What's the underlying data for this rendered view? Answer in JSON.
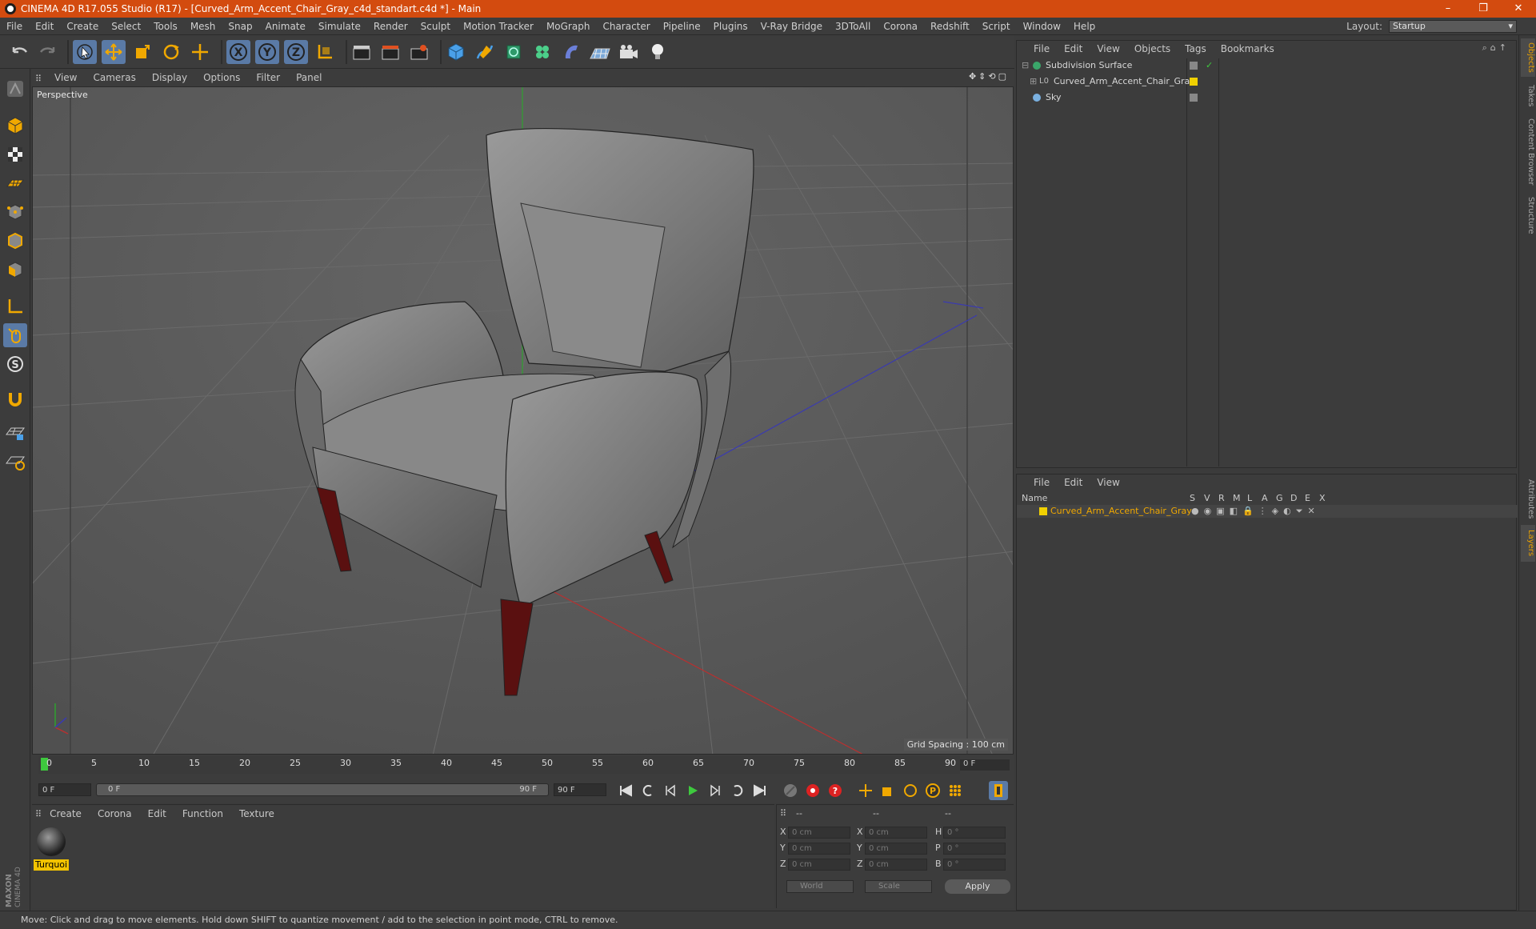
{
  "window": {
    "title": "CINEMA 4D R17.055 Studio (R17) - [Curved_Arm_Accent_Chair_Gray_c4d_standart.c4d *] - Main",
    "minimize": "–",
    "restore": "❐",
    "close": "✕"
  },
  "menubar": {
    "items": [
      "File",
      "Edit",
      "Create",
      "Select",
      "Tools",
      "Mesh",
      "Snap",
      "Animate",
      "Simulate",
      "Render",
      "Sculpt",
      "Motion Tracker",
      "MoGraph",
      "Character",
      "Pipeline",
      "Plugins",
      "V-Ray Bridge",
      "3DToAll",
      "Corona",
      "Redshift",
      "Script",
      "Window",
      "Help"
    ],
    "layout_label": "Layout:",
    "layout_value": "Startup"
  },
  "viewport": {
    "menu": [
      "View",
      "Cameras",
      "Display",
      "Options",
      "Filter",
      "Panel"
    ],
    "label": "Perspective",
    "grid_spacing": "Grid Spacing : 100 cm"
  },
  "timeline": {
    "ticks": [
      "0",
      "5",
      "10",
      "15",
      "20",
      "25",
      "30",
      "35",
      "40",
      "45",
      "50",
      "55",
      "60",
      "65",
      "70",
      "75",
      "80",
      "85",
      "90"
    ],
    "end_frame_ruler": "0 F",
    "current_frame": "0 F",
    "range_start": "0 F",
    "range_end": "90 F",
    "max_frame": "90 F"
  },
  "material_manager": {
    "menu": [
      "Create",
      "Corona",
      "Edit",
      "Function",
      "Texture"
    ],
    "material_name": "Turquoi"
  },
  "coordinates": {
    "header": [
      "--",
      "--",
      "--"
    ],
    "rows": [
      {
        "a": "X",
        "av": "0 cm",
        "b": "X",
        "bv": "0 cm",
        "c": "H",
        "cv": "0 °"
      },
      {
        "a": "Y",
        "av": "0 cm",
        "b": "Y",
        "bv": "0 cm",
        "c": "P",
        "cv": "0 °"
      },
      {
        "a": "Z",
        "av": "0 cm",
        "b": "Z",
        "bv": "0 cm",
        "c": "B",
        "cv": "0 °"
      }
    ],
    "space": "World",
    "mode": "Scale",
    "apply": "Apply"
  },
  "objects_panel": {
    "menu": [
      "File",
      "Edit",
      "View",
      "Objects",
      "Tags",
      "Bookmarks"
    ],
    "items": [
      {
        "name": "Subdivision Surface"
      },
      {
        "name": "Curved_Arm_Accent_Chair_Gray"
      },
      {
        "name": "Sky"
      }
    ]
  },
  "layers_panel": {
    "menu": [
      "File",
      "Edit",
      "View"
    ],
    "columns": [
      "Name",
      "S",
      "V",
      "R",
      "M",
      "L",
      "A",
      "G",
      "D",
      "E",
      "X"
    ],
    "layer_name": "Curved_Arm_Accent_Chair_Gray"
  },
  "side_tabs": [
    "Objects",
    "Takes",
    "Content Browser",
    "Structure",
    "Attributes",
    "Layers"
  ],
  "status": "Move: Click and drag to move elements. Hold down SHIFT to quantize movement / add to the selection in point mode, CTRL to remove.",
  "logo": "MAXON CINEMA 4D",
  "colors": {
    "title_bar": "#d34b0f",
    "selected_tool": "#5a7aa6",
    "material_label": "#f2c300",
    "layer_name": "#f0a800"
  }
}
